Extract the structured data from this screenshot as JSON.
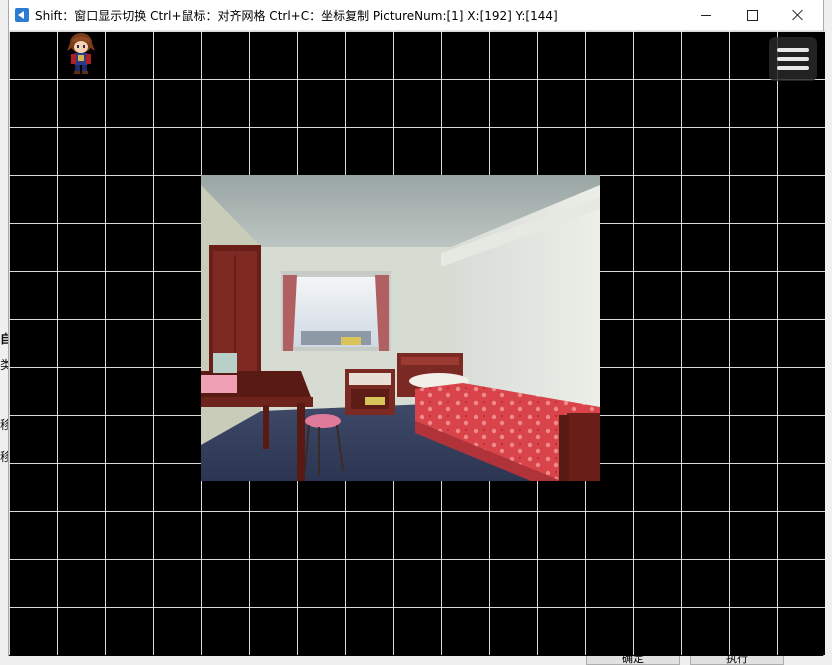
{
  "window": {
    "title": "Shift：窗口显示切换 Ctrl+鼠标：对齐网格 Ctrl+C：坐标复制 PictureNum:[1] X:[192] Y:[144]"
  },
  "background_window": {
    "fragments": [
      "自",
      "类",
      "移",
      "移"
    ],
    "buttons": [
      "确定",
      "执行"
    ]
  },
  "game": {
    "picture_num": 1,
    "grid_size": 48,
    "picture_description": "bedroom"
  },
  "colors": {
    "grid_line": "#ffffff",
    "background": "#000000",
    "titlebar": "#ffffff"
  }
}
